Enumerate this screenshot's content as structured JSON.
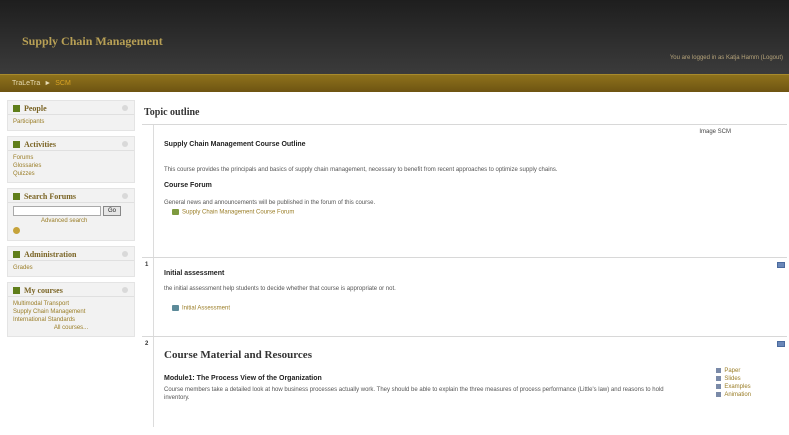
{
  "header": {
    "site_title": "Supply Chain Management",
    "login_info": "You are logged in as Katja Hamm (Logout)"
  },
  "nav": {
    "home": "TraLeTra",
    "separator": "►",
    "current": "SCM"
  },
  "sidebar": {
    "people": {
      "title": "People",
      "links": [
        "Participants"
      ]
    },
    "activities": {
      "title": "Activities",
      "links": [
        "Forums",
        "Glossaries",
        "Quizzes"
      ]
    },
    "search_forums": {
      "title": "Search Forums",
      "go_label": "Go",
      "advanced_label": "Advanced search"
    },
    "administration": {
      "title": "Administration",
      "links": [
        "Grades"
      ]
    },
    "my_courses": {
      "title": "My courses",
      "links": [
        "Multimodal Transport",
        "Supply Chain Management",
        "International Standards"
      ],
      "all_label": "All courses..."
    }
  },
  "main": {
    "title": "Topic outline",
    "section0": {
      "image_label": "Image SCM",
      "summary_title": "Supply Chain Management Course Outline",
      "summary_text": "This course provides the principals and basics of supply chain management, necessary to benefit from recent approaches to optimize supply chains.",
      "forum_heading": "Course Forum",
      "forum_text": "General news and announcements will be published in the forum of this course.",
      "forum_link": "Supply Chain Management Course Forum"
    },
    "section1": {
      "number": "1",
      "heading": "Initial assessment",
      "text": "the initial assessment help students to decide whether that course is appropriate or not.",
      "link": "Initial Assessment"
    },
    "section2": {
      "number": "2",
      "heading": "Course Material and Resources",
      "module_title": "Module1: The Process View of the Organization",
      "module_text": "Course members take a detailed look at how business processes actually work. They should be able to explain the three measures of process performance (Little's law) and reasons to hold inventory.",
      "links": [
        "Paper",
        "Slides",
        "Examples",
        "Animation"
      ]
    }
  }
}
